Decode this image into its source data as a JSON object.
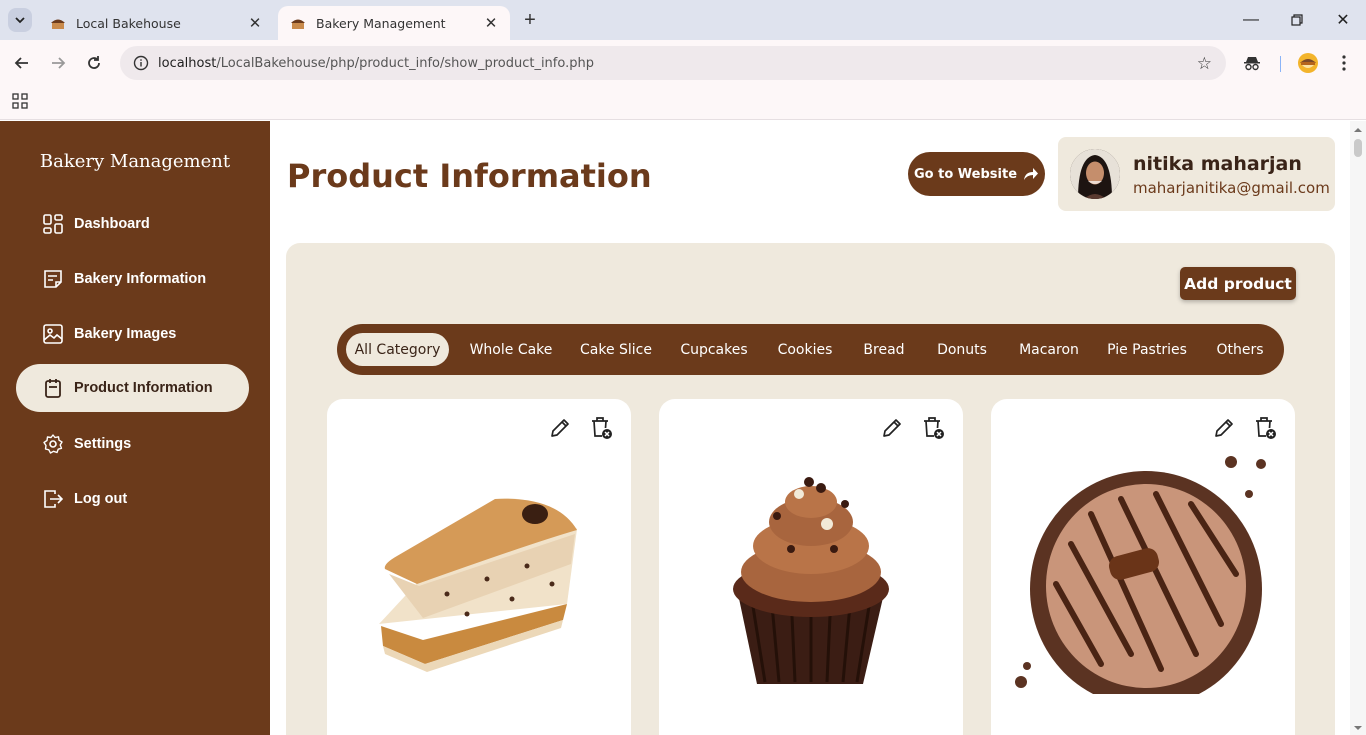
{
  "browser": {
    "tabs": [
      {
        "title": "Local Bakehouse",
        "active": false
      },
      {
        "title": "Bakery Management",
        "active": true
      }
    ],
    "url_host": "localhost",
    "url_path": "/LocalBakehouse/php/product_info/show_product_info.php"
  },
  "sidebar": {
    "brand": "Bakery Management",
    "items": [
      {
        "label": "Dashboard",
        "icon": "dashboard-icon"
      },
      {
        "label": "Bakery Information",
        "icon": "document-icon"
      },
      {
        "label": "Bakery Images",
        "icon": "image-icon"
      },
      {
        "label": "Product Information",
        "icon": "clipboard-icon",
        "active": true
      },
      {
        "label": "Settings",
        "icon": "gear-icon"
      },
      {
        "label": "Log out",
        "icon": "logout-icon"
      }
    ]
  },
  "header": {
    "title": "Product Information",
    "goto_label": "Go to Website",
    "user_name": "nitika maharjan",
    "user_email": "maharjanitika@gmail.com"
  },
  "products": {
    "add_label": "Add product",
    "categories": [
      "All Category",
      "Whole Cake",
      "Cake Slice",
      "Cupcakes",
      "Cookies",
      "Bread",
      "Donuts",
      "Macaron",
      "Pie Pastries",
      "Others"
    ],
    "active_category": "All Category",
    "cards": [
      {
        "image": "cake-slice-image"
      },
      {
        "image": "cupcake-image"
      },
      {
        "image": "cookie-pie-image"
      }
    ]
  },
  "colors": {
    "brand_brown": "#6b3a1b",
    "cream": "#efe9dd"
  }
}
